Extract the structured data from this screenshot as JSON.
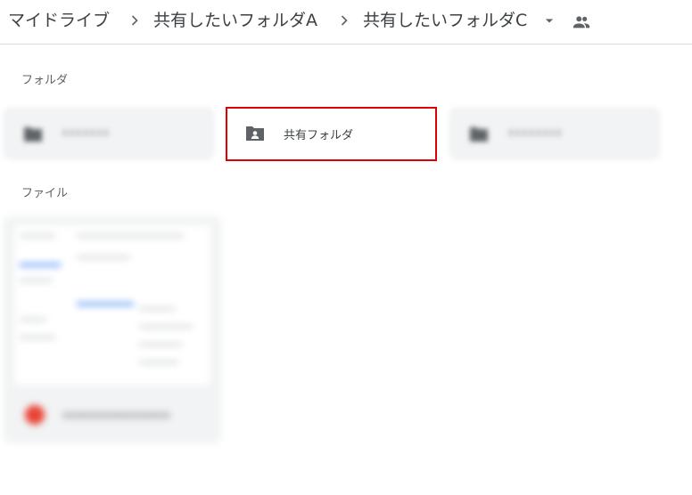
{
  "breadcrumb": {
    "items": [
      "マイドライブ",
      "共有したいフォルダA",
      "共有したいフォルダC"
    ]
  },
  "sections": {
    "folders_label": "フォルダ",
    "files_label": "ファイル"
  },
  "folders": [
    {
      "name": "xxxxxxx",
      "icon": "folder-icon",
      "blurred": true
    },
    {
      "name": "共有フォルダ",
      "icon": "shared-folder-icon",
      "blurred": false,
      "highlighted": true
    },
    {
      "name": "xxxxxxxx",
      "icon": "folder-icon",
      "blurred": true
    }
  ],
  "files": [
    {
      "name": "xxxxxxxxxxxxxxxxx",
      "icon": "pdf-icon",
      "blurred": true
    }
  ],
  "colors": {
    "highlight": "#e00000",
    "divider": "#dadce0",
    "icon": "#5f6368"
  }
}
